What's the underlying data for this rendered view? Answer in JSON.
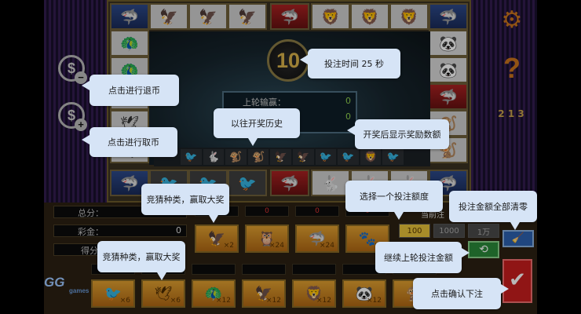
{
  "timer": {
    "value": "10"
  },
  "last_round": {
    "label": "上轮输赢：",
    "value1": "0",
    "value2": "0"
  },
  "stats": {
    "total_label": "总分：",
    "jackpot_label": "彩金：",
    "jackpot_value": "0",
    "score_label": "得分"
  },
  "bets": [
    {
      "icon": "eagle-icon",
      "glyph": "🦅",
      "mult": "×2"
    },
    {
      "icon": "owl-icon",
      "glyph": "🦉",
      "mult": "×24"
    },
    {
      "icon": "shark-icon",
      "glyph": "🦈",
      "mult": "×24"
    },
    {
      "icon": "pawprint-icon",
      "glyph": "🐾",
      "mult": "×2"
    }
  ],
  "bet_top_values": [
    "0",
    "0",
    "0",
    "0"
  ],
  "animal_bets": [
    {
      "icon": "swallow-icon",
      "glyph": "🐦",
      "mult": "×6"
    },
    {
      "icon": "pigeon-icon",
      "glyph": "🕊",
      "mult": "×6"
    },
    {
      "icon": "peacock-icon",
      "glyph": "🦚",
      "mult": "×12"
    },
    {
      "icon": "hawk-icon",
      "glyph": "🦅",
      "mult": "×12"
    },
    {
      "icon": "lion-icon",
      "glyph": "🦁",
      "mult": "×12"
    },
    {
      "icon": "panda-icon",
      "glyph": "🐼",
      "mult": "×12"
    },
    {
      "icon": "monkey-icon",
      "glyph": "🐒",
      "mult": "×8"
    }
  ],
  "amounts": {
    "label": "当前注",
    "a100": "100",
    "a1000": "1000",
    "a10k": "1万"
  },
  "logo": {
    "text": "GG",
    "sub": "games"
  },
  "callouts": {
    "withdraw": "点击进行退币",
    "deposit": "点击进行取币",
    "bet_time": "投注时间 25 秒",
    "history": "以往开奖历史",
    "reward": "开奖后显示奖励数额",
    "guess_top": "竞猜种类，赢取大奖",
    "choose_amount": "选择一个投注额度",
    "clear": "投注金额全部清零",
    "guess_bottom": "竞猜种类，赢取大奖",
    "repeat": "继续上轮投注金额",
    "confirm": "点击确认下注"
  },
  "colors": {
    "accent_orange": "#c9731c",
    "callout_bg": "#d6e4f6",
    "confirm_red": "#c81e1e"
  }
}
